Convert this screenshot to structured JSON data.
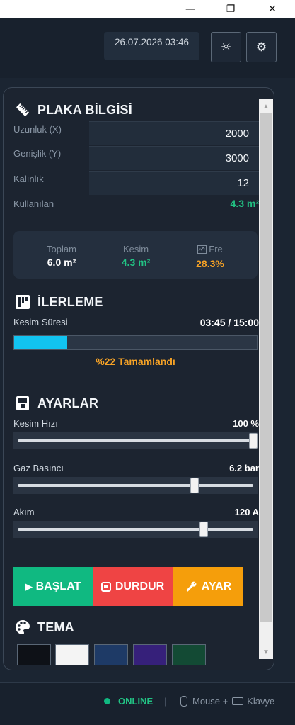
{
  "window": {
    "minimize_icon": "—",
    "restore_icon": "❐",
    "close_icon": "✕"
  },
  "header": {
    "datetime": "26.07.2026 03:46",
    "theme_icon": "☼",
    "settings_icon": "⚙"
  },
  "plate": {
    "title": "PLAKA BİLGİSİ",
    "length_label": "Uzunluk (X)",
    "length_value": "2000",
    "width_label": "Genişlik (Y)",
    "width_value": "3000",
    "thickness_label": "Kalınlık",
    "thickness_value": "12",
    "used_label": "Kullanılan",
    "used_value": "4.3 m²"
  },
  "summary": {
    "total_label": "Toplam",
    "total_value": "6.0 m²",
    "cut_label": "Kesim",
    "cut_value": "4.3 m²",
    "free_label": "Fre",
    "free_value": "28.3%"
  },
  "progress": {
    "title": "İLERLEME",
    "time_label": "Kesim Süresi",
    "time_value": "03:45 / 15:00",
    "percent": 22,
    "status": "%22 Tamamlandı"
  },
  "settings": {
    "title": "AYARLAR",
    "speed_label": "Kesim Hızı",
    "speed_value": "100 %",
    "speed_level": 1.0,
    "gas_label": "Gaz Basıncı",
    "gas_value": "6.2 bar",
    "gas_level": 0.75,
    "current_label": "Akım",
    "current_value": "120 A",
    "current_level": 0.79
  },
  "actions": {
    "start_label": "BAŞLAT",
    "stop_label": "DURDUR",
    "adjust_label": "AYAR"
  },
  "theme": {
    "title": "TEMA"
  },
  "footer": {
    "status": "ONLINE",
    "separator": "|",
    "input_mode": "Mouse +",
    "keyboard_label": "Klavye"
  },
  "colors": {
    "green": "#22c384",
    "red": "#ef4444",
    "orange": "#f59e0b",
    "cyan": "#12c3f0"
  }
}
